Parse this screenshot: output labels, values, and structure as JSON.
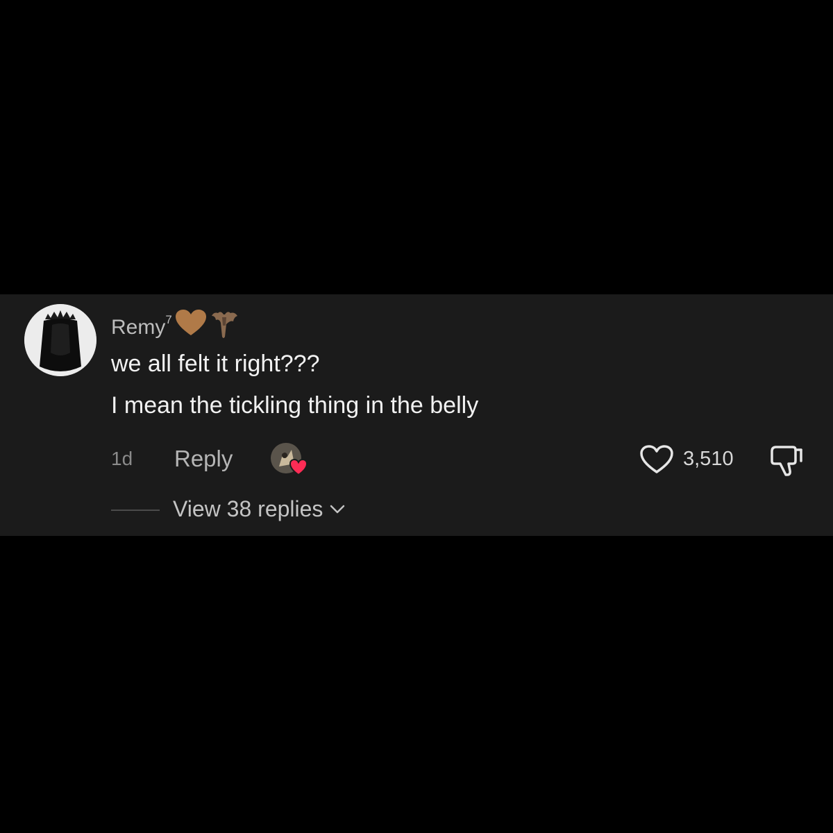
{
  "comment": {
    "username": "Remy",
    "username_superscript": "7",
    "username_emojis": [
      "brown-heart-icon",
      "bat-icon"
    ],
    "lines": [
      "we all felt it right???",
      "I mean the tickling thing in the belly"
    ],
    "timestamp": "1d",
    "reply_label": "Reply",
    "creator_liked": true,
    "like_count": "3,510",
    "view_replies_label": "View 38 replies"
  },
  "colors": {
    "page_background": "#000000",
    "card_background": "#1b1b1b",
    "brown_heart": "#b07a48",
    "creator_heart": "#fe2c55"
  }
}
